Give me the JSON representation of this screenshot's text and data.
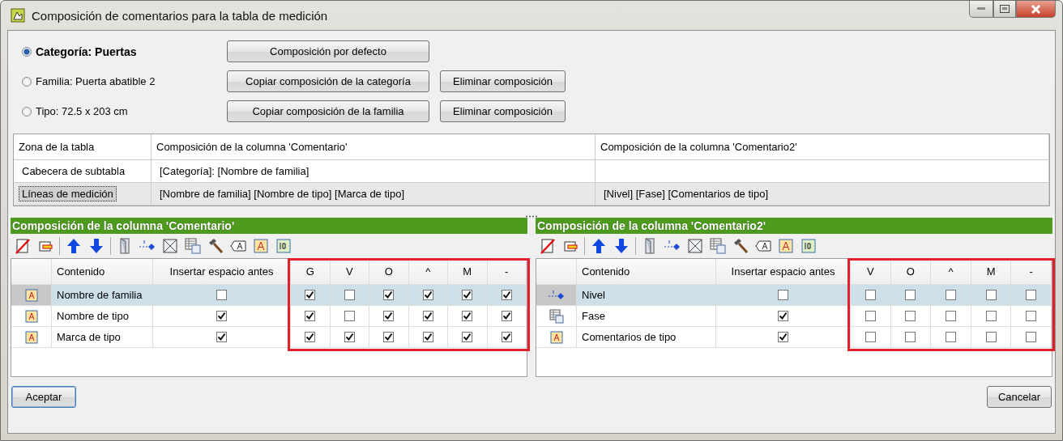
{
  "window": {
    "title": "Composición de comentarios para la tabla de medición"
  },
  "scope_options": [
    {
      "label": "Categoría: Puertas",
      "selected": true
    },
    {
      "label": "Familia: Puerta abatible 2",
      "selected": false
    },
    {
      "label": "Tipo: 72.5 x 203 cm",
      "selected": false
    }
  ],
  "scope_buttons": [
    [
      "Composición por defecto"
    ],
    [
      "Copiar composición de la categoría",
      "Eliminar composición"
    ],
    [
      "Copiar composición de la familia",
      "Eliminar composición"
    ]
  ],
  "zone_table": {
    "columns": [
      "Zona de la tabla",
      "Composición de la columna 'Comentario'",
      "Composición de la columna 'Comentario2'"
    ],
    "rows": [
      {
        "cells": [
          "Cabecera de subtabla",
          "[Categoría]: [Nombre de familia]",
          ""
        ],
        "selected": false
      },
      {
        "cells": [
          "Líneas de medición",
          "[Nombre de familia] [Nombre de tipo] [Marca de tipo]",
          "[Nivel] [Fase] [Comentarios de tipo]"
        ],
        "selected": true
      }
    ]
  },
  "panels": [
    {
      "title": "Composición de la columna 'Comentario'",
      "columns": [
        "Contenido",
        "Insertar espacio antes"
      ],
      "flag_columns": [
        "G",
        "V",
        "O",
        "^",
        "M",
        "-"
      ],
      "rows": [
        {
          "kind": "text",
          "content": "Nombre de familia",
          "space_before": false,
          "selected": true,
          "flags": [
            true,
            false,
            true,
            true,
            true,
            true
          ]
        },
        {
          "kind": "text",
          "content": "Nombre de tipo",
          "space_before": true,
          "selected": false,
          "flags": [
            true,
            false,
            true,
            true,
            true,
            true
          ]
        },
        {
          "kind": "text",
          "content": "Marca de tipo",
          "space_before": true,
          "selected": false,
          "flags": [
            true,
            true,
            true,
            true,
            true,
            true
          ]
        }
      ]
    },
    {
      "title": "Composición de la columna 'Comentario2'",
      "columns": [
        "Contenido",
        "Insertar espacio antes"
      ],
      "flag_columns": [
        "V",
        "O",
        "^",
        "M",
        "-"
      ],
      "rows": [
        {
          "kind": "level",
          "content": "Nivel",
          "space_before": false,
          "selected": true,
          "flags": [
            false,
            false,
            false,
            false,
            false
          ]
        },
        {
          "kind": "phase",
          "content": "Fase",
          "space_before": true,
          "selected": false,
          "flags": [
            false,
            false,
            false,
            false,
            false
          ]
        },
        {
          "kind": "text",
          "content": "Comentarios de tipo",
          "space_before": true,
          "selected": false,
          "flags": [
            false,
            false,
            false,
            false,
            false
          ]
        }
      ]
    }
  ],
  "footer_buttons": [
    "Aceptar",
    "Cancelar"
  ]
}
